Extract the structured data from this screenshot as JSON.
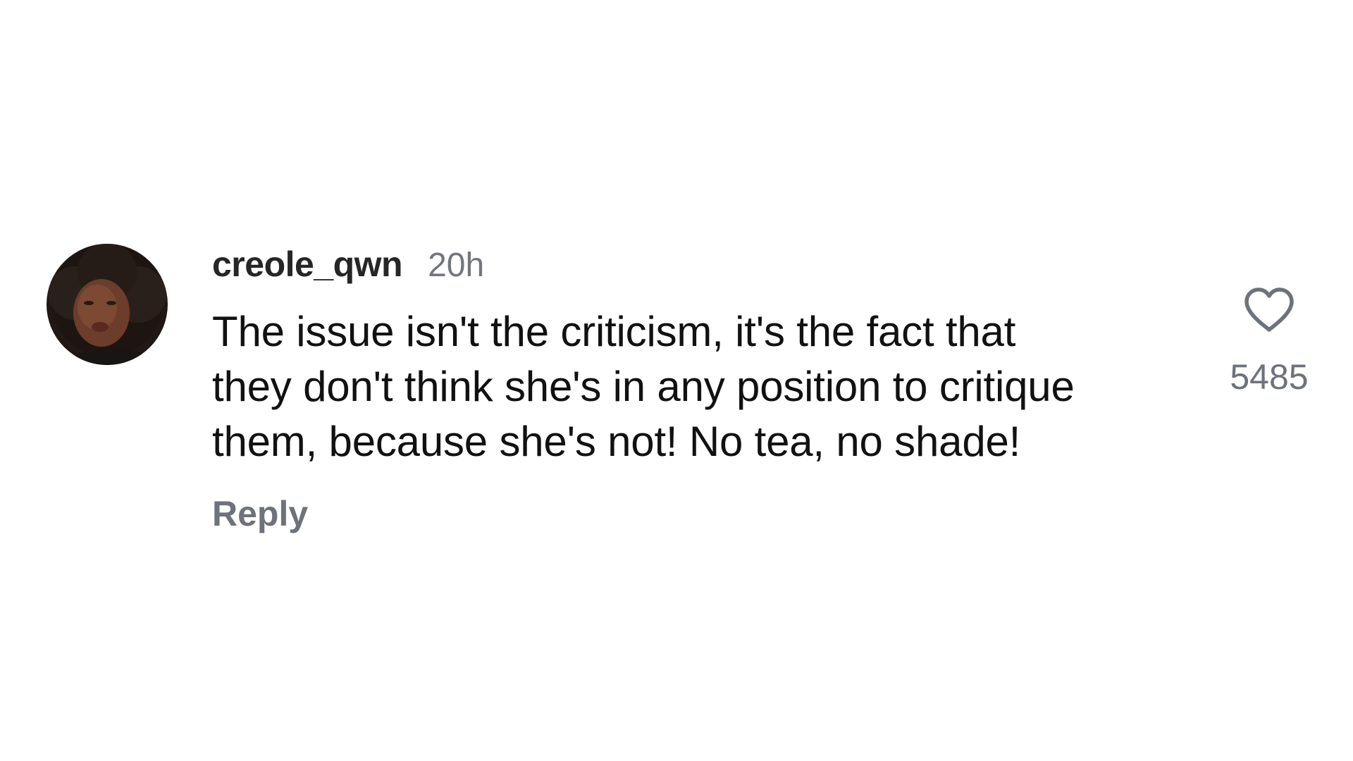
{
  "comment": {
    "username": "creole_qwn",
    "timestamp": "20h",
    "text": "The issue isn't the criticism, it's the fact that\nthey don't think she's in any position to critique\nthem, because she's not! No tea, no shade!",
    "reply_label": "Reply",
    "like_count": "5485",
    "like_icon": "heart-outline-icon",
    "avatar_icon": "user-avatar-photo"
  },
  "colors": {
    "background": "#ffffff",
    "username": "#262626",
    "text": "#111111",
    "secondary": "#73777c"
  }
}
